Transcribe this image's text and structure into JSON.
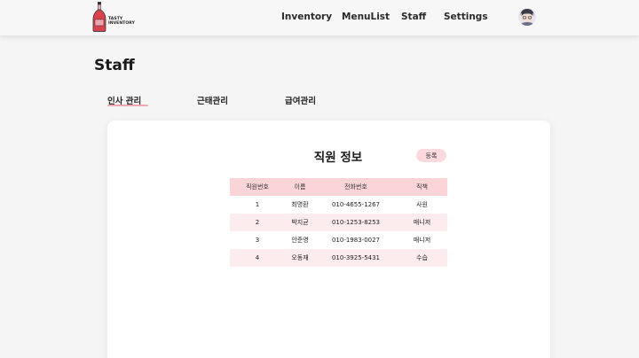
{
  "header": {
    "logo_text_line1": "TASTY",
    "logo_text_line2": "INVENTORY",
    "nav": [
      {
        "label": "Inventory"
      },
      {
        "label": "MenuList"
      },
      {
        "label": "Staff"
      },
      {
        "label": "Settings"
      }
    ]
  },
  "page": {
    "title": "Staff",
    "tabs": [
      {
        "label": "인사 관리",
        "active": true
      },
      {
        "label": "근태관리",
        "active": false
      },
      {
        "label": "급여관리",
        "active": false
      }
    ]
  },
  "card": {
    "title": "직원 정보",
    "register_label": "등록",
    "table": {
      "headers": [
        "직원번호",
        "이름",
        "전화번호",
        "직책"
      ],
      "rows": [
        [
          "1",
          "최명환",
          "010-4655-1267",
          "사원"
        ],
        [
          "2",
          "박지균",
          "010-1253-8253",
          "매니저"
        ],
        [
          "3",
          "안준영",
          "010-1983-0027",
          "매니저"
        ],
        [
          "4",
          "오동재",
          "010-3925-5431",
          "수습"
        ]
      ]
    }
  },
  "colors": {
    "accent_pink": "#fbd4d8",
    "row_alt": "#fdecee",
    "tab_underline": "#f2a8b4",
    "bottle_red": "#d9434e"
  }
}
